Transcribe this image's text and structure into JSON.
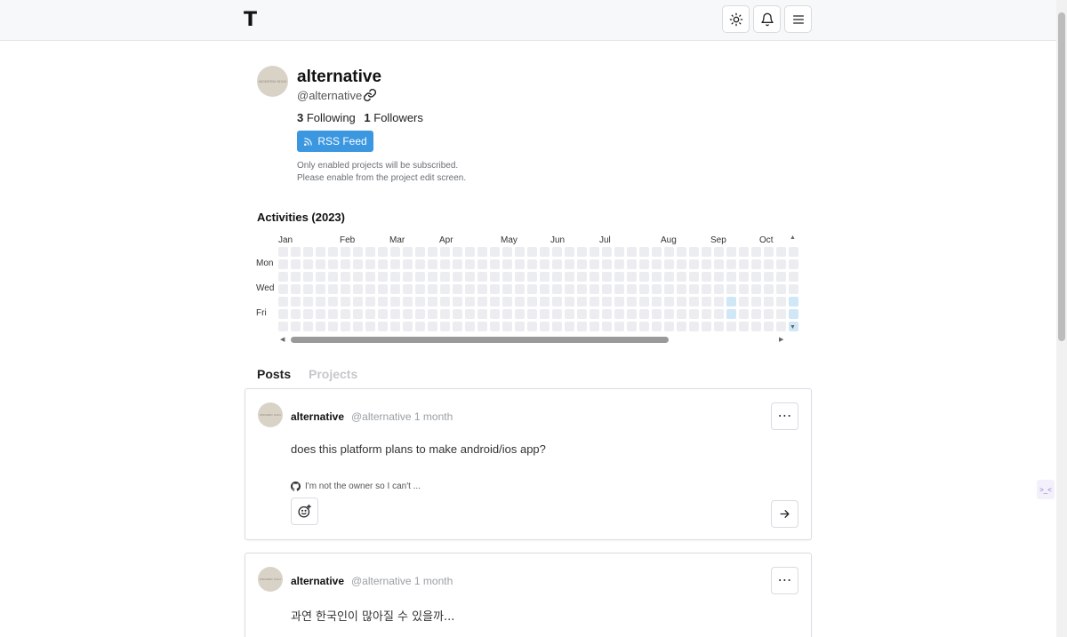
{
  "header": {
    "logo": "T",
    "buttons": [
      {
        "name": "theme-toggle-button",
        "icon": "sun-icon"
      },
      {
        "name": "notifications-button",
        "icon": "bell-icon"
      },
      {
        "name": "menu-button",
        "icon": "hamburger-icon"
      }
    ]
  },
  "profile": {
    "avatar_text": "MODERN SIGN",
    "name": "alternative",
    "handle": "@alternative",
    "following_count": "3",
    "following_label": "Following",
    "followers_count": "1",
    "followers_label": "Followers",
    "rss_label": "RSS Feed",
    "rss_note_line1": "Only enabled projects will be subscribed.",
    "rss_note_line2": "Please enable from the project edit screen."
  },
  "activities": {
    "title": "Activities (2023)",
    "months": [
      "Jan",
      "Feb",
      "Mar",
      "Apr",
      "May",
      "Jun",
      "Jul",
      "Aug",
      "Sep",
      "Oct"
    ],
    "days": [
      "Mon",
      "Wed",
      "Fri"
    ]
  },
  "tabs": [
    {
      "label": "Posts",
      "active": true
    },
    {
      "label": "Projects",
      "active": false
    }
  ],
  "posts": [
    {
      "author": "alternative",
      "handle": "@alternative",
      "time": "1 month",
      "body": "does this platform plans to make android/ios app?",
      "reply_preview": "I'm not the owner so I can't ..."
    },
    {
      "author": "alternative",
      "handle": "@alternative",
      "time": "1 month",
      "body": "과연 한국인이 많아질 수 있을까..."
    }
  ],
  "colors": {
    "accent": "#3b97e0",
    "heat_empty": "#ebedf0",
    "heat_level1": "#cfe7f7"
  }
}
